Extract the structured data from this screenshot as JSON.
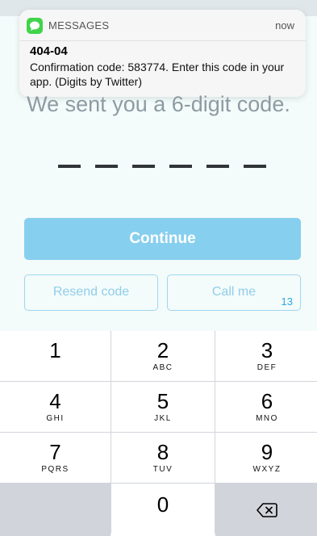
{
  "notification": {
    "app_name": "MESSAGES",
    "time": "now",
    "sender": "404-04",
    "message": "Confirmation code: 583774. Enter this code in your app. (Digits by Twitter)",
    "app_color": "#3fd44a"
  },
  "verify": {
    "headline": "We sent you a 6-digit code.",
    "code_length": 6,
    "continue_label": "Continue",
    "resend_label": "Resend code",
    "call_label": "Call me",
    "call_countdown": "13"
  },
  "keypad": {
    "keys": [
      {
        "digit": "1",
        "letters": ""
      },
      {
        "digit": "2",
        "letters": "ABC"
      },
      {
        "digit": "3",
        "letters": "DEF"
      },
      {
        "digit": "4",
        "letters": "GHI"
      },
      {
        "digit": "5",
        "letters": "JKL"
      },
      {
        "digit": "6",
        "letters": "MNO"
      },
      {
        "digit": "7",
        "letters": "PQRS"
      },
      {
        "digit": "8",
        "letters": "TUV"
      },
      {
        "digit": "9",
        "letters": "WXYZ"
      },
      {
        "digit": "0",
        "letters": ""
      }
    ],
    "delete_icon": "delete-backspace-icon"
  },
  "colors": {
    "accent": "#87cfee",
    "accent_border": "#9fd6ef",
    "countdown": "#2da8e0"
  }
}
